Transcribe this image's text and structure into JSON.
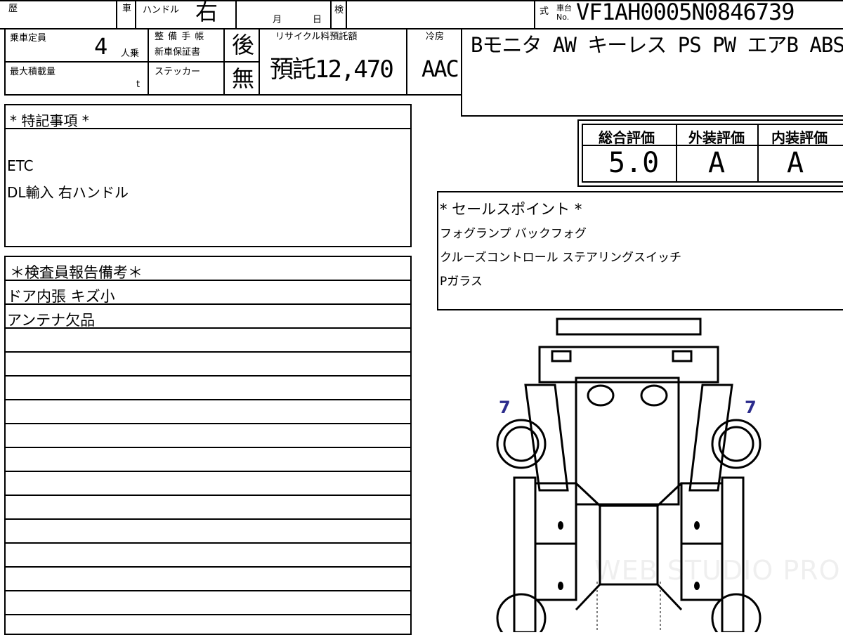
{
  "header": {
    "reki_label": "歴",
    "sha_label": "車",
    "handle_label": "ハンドル",
    "handle_value": "右",
    "month_label": "月",
    "day_label": "日",
    "ken_label": "検",
    "shiki_label": "式",
    "chassis_label_top": "車台",
    "chassis_label_bottom": "No.",
    "chassis_value": "VF1AH0005N0846739"
  },
  "specs": {
    "capacity_label": "乗車定員",
    "capacity_value": "4",
    "capacity_unit": "人乗",
    "maintenance_label_1": "整 備 手 帳",
    "maintenance_label_2": "新車保証書",
    "maintenance_value": "後",
    "sticker_label": "ステッカー",
    "sticker_value": "無",
    "maxload_label": "最大積載量",
    "maxload_unit": "t",
    "recycle_label": "リサイクル料預託額",
    "recycle_value": "預託12,470",
    "cooling_label": "冷房",
    "cooling_value": "AAC"
  },
  "equipment": {
    "text": "Bモニタ AW キーレス PS PW エアB ABS"
  },
  "ratings": {
    "headers": [
      "総合評価",
      "外装評価",
      "内装評価"
    ],
    "values": [
      "5.0",
      "A",
      "A"
    ]
  },
  "special_notes": {
    "title": "* 特記事項 *",
    "lines": [
      "ETC",
      "DL輸入 右ハンドル"
    ]
  },
  "inspector": {
    "title": "＊検査員報告備考＊",
    "lines": [
      "ドア内張 キズ小",
      "アンテナ欠品"
    ]
  },
  "sales": {
    "title": "* セールスポイント *",
    "lines": [
      "フォグランプ バックフォグ",
      "クルーズコントロール ステアリングスイッチ",
      "Pガラス"
    ]
  },
  "diagram": {
    "left_mark": "7",
    "right_mark": "7"
  },
  "watermark": "WEB STUDIO PRO"
}
